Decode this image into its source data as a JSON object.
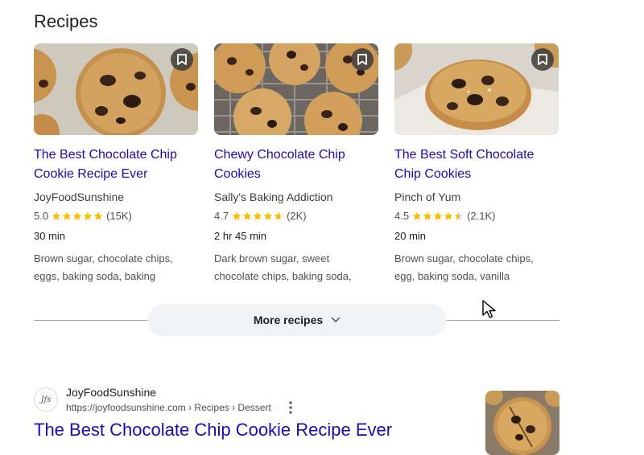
{
  "section": {
    "title": "Recipes"
  },
  "cards": [
    {
      "title_line1": "The Best Chocolate Chip",
      "title_line2": "Cookie Recipe Ever",
      "source": "JoyFoodSunshine",
      "rating_text": "5.0",
      "rating_value": 5.0,
      "count": "(15K)",
      "time": "30 min",
      "ingredients_line1": "Brown sugar, chocolate chips,",
      "ingredients_line2": "eggs, baking soda, baking"
    },
    {
      "title_line1": "Chewy Chocolate Chip",
      "title_line2": "Cookies",
      "source": "Sally's Baking Addiction",
      "rating_text": "4.7",
      "rating_value": 4.7,
      "count": "(2K)",
      "time": "2 hr 45 min",
      "ingredients_line1": "Dark brown sugar, sweet",
      "ingredients_line2": "chocolate chips, baking soda,"
    },
    {
      "title_line1": "The Best Soft Chocolate",
      "title_line2": "Chip Cookies",
      "source": "Pinch of Yum",
      "rating_text": "4.5",
      "rating_value": 4.5,
      "count": "(2.1K)",
      "time": "20 min",
      "ingredients_line1": "Brown sugar, chocolate chips,",
      "ingredients_line2": "egg, baking soda, vanilla"
    }
  ],
  "more": {
    "label": "More recipes"
  },
  "result": {
    "site_name": "JoyFoodSunshine",
    "url": "https://joyfoodsunshine.com › Recipes › Dessert",
    "title": "The Best Chocolate Chip Cookie Recipe Ever",
    "favicon_text": "Jfs"
  },
  "colors": {
    "link": "#1a0dab",
    "star": "#fbbc04",
    "button_bg": "#f1f3f4"
  },
  "icons": [
    "bookmark-icon",
    "star-icon",
    "chevron-down-icon",
    "more-vert-icon",
    "mouse-pointer-icon"
  ]
}
